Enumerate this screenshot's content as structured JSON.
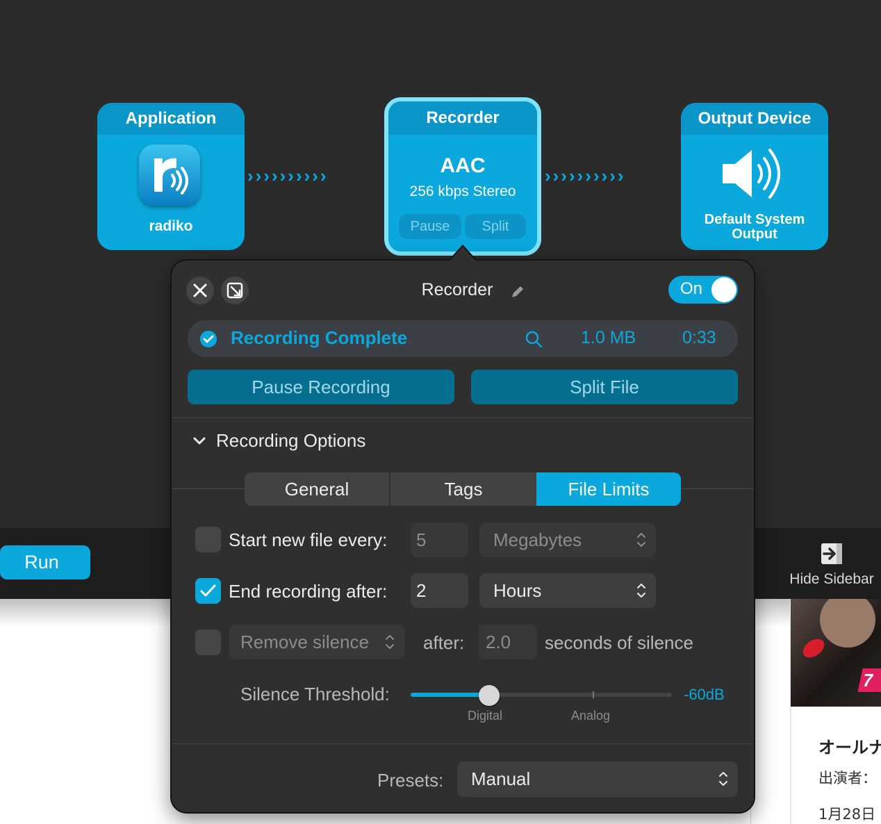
{
  "workflow": {
    "application": {
      "title": "Application",
      "app_name": "radiko",
      "icon": "radiko-app-icon"
    },
    "recorder": {
      "title": "Recorder",
      "format": "AAC",
      "quality": "256 kbps Stereo",
      "pause_label": "Pause",
      "split_label": "Split"
    },
    "output": {
      "title": "Output Device",
      "device_name": "Default System Output",
      "icon": "speaker-icon"
    },
    "connector": "››››››››››"
  },
  "toolbar": {
    "run_label": "Run",
    "hide_sidebar_label": "Hide Sidebar"
  },
  "sidebar": {
    "title": "オールナ",
    "cast": "出演者：",
    "date": "1月28日",
    "logo_text": "7"
  },
  "popover": {
    "title": "Recorder",
    "toggle_label": "On",
    "status": {
      "text": "Recording Complete",
      "size": "1.0 MB",
      "duration": "0:33"
    },
    "pause_recording_label": "Pause Recording",
    "split_file_label": "Split File",
    "section_title": "Recording Options",
    "tabs": [
      {
        "label": "General",
        "active": false
      },
      {
        "label": "Tags",
        "active": false
      },
      {
        "label": "File Limits",
        "active": true
      }
    ],
    "file_limits": {
      "start_new_file": {
        "checked": false,
        "label": "Start new file every:",
        "value": "5",
        "unit": "Megabytes"
      },
      "end_recording": {
        "checked": true,
        "label": "End recording after:",
        "value": "2",
        "unit": "Hours"
      },
      "remove_silence": {
        "checked": false,
        "mode": "Remove silence",
        "after_label": "after:",
        "value": "2.0",
        "suffix": "seconds of silence"
      },
      "silence_threshold": {
        "label": "Silence Threshold:",
        "value": "-60dB",
        "fraction": 0.3,
        "min_label": "Digital",
        "max_label": "Analog"
      }
    },
    "presets": {
      "label": "Presets:",
      "value": "Manual"
    }
  },
  "colors": {
    "accent": "#0aa8dc",
    "panel": "#2f2f2f",
    "background": "#2b2b2b"
  }
}
